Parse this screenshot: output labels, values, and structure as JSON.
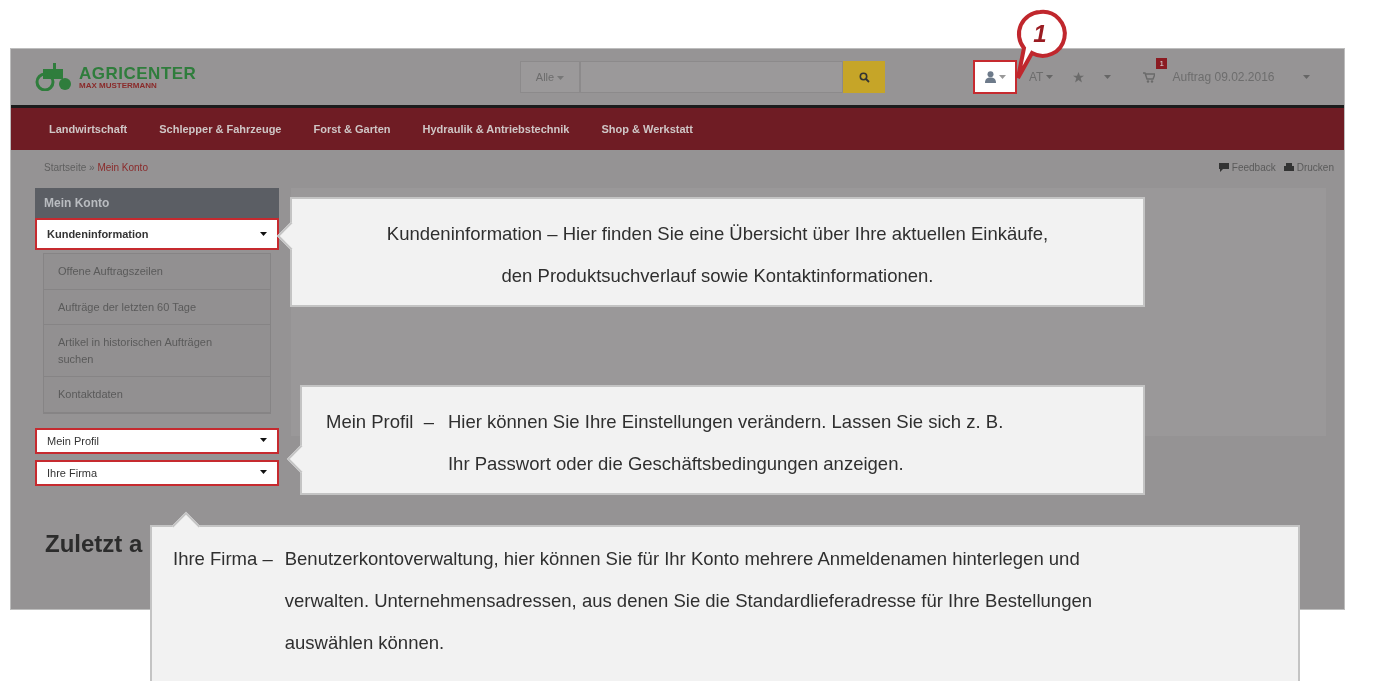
{
  "site": {
    "logo": {
      "name": "AGRICENTER",
      "subtitle": "MAX MUSTERMANN"
    },
    "search": {
      "category": "Alle"
    },
    "account_button": {
      "highlighted": true
    },
    "language": "AT",
    "cart": {
      "badge": "1",
      "label": "Auftrag 09.02.2016"
    },
    "nav": [
      "Landwirtschaft",
      "Schlepper & Fahrzeuge",
      "Forst & Garten",
      "Hydraulik & Antriebstechnik",
      "Shop & Werkstatt"
    ],
    "breadcrumb": {
      "home": "Startseite",
      "separator": "»",
      "current": "Mein Konto"
    },
    "page_actions": [
      {
        "kind": "feedback",
        "label": "Feedback"
      },
      {
        "kind": "print",
        "label": "Drucken"
      }
    ],
    "sidebar": {
      "title": "Mein Konto",
      "sections": [
        {
          "label": "Kundeninformation",
          "highlighted": true,
          "expanded": true,
          "children": [
            {
              "label": "Offene Auftragszeilen"
            },
            {
              "label": "Aufträge der letzten 60 Tage"
            },
            {
              "label": "Artikel in historischen Aufträgen suchen"
            },
            {
              "label": "Kontaktdaten"
            }
          ]
        },
        {
          "label": "Mein Profil",
          "highlighted": true,
          "expanded": false
        },
        {
          "label": "Ihre Firma",
          "highlighted": true,
          "expanded": false
        }
      ]
    },
    "recent_heading": "Zuletzt a"
  },
  "marker": "1",
  "callouts": [
    {
      "kind": "centered",
      "lines": [
        "Kundeninformation – Hier finden Sie eine Übersicht über Ihre aktuellen Einkäufe,",
        "den Produktsuchverlauf sowie Kontaktinformationen."
      ]
    },
    {
      "kind": "hanging",
      "label": "Mein Profil  –",
      "lines": [
        "Hier können Sie Ihre Einstellungen verändern. Lassen Sie sich z. B.",
        "Ihr Passwort oder die Geschäftsbedingungen anzeigen."
      ]
    },
    {
      "kind": "hanging",
      "label": "Ihre Firma –",
      "lines": [
        "Benutzerkontoverwaltung, hier können Sie für Ihr Konto mehrere Anmeldenamen hinterlegen und",
        "verwalten. Unternehmensadressen, aus denen Sie die Standardlieferadresse für Ihre Bestellungen",
        "auswählen können."
      ]
    }
  ]
}
